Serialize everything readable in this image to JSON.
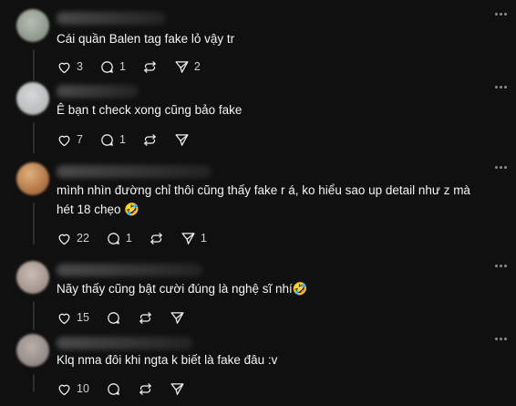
{
  "posts": [
    {
      "text": "Cái quần Balen tag fake lỏ vậy tr",
      "likes": "3",
      "replies": "1",
      "reposts": "",
      "shares": "2",
      "avatar_color": "#9ea69c"
    },
    {
      "text": "Ê bạn t check xong cũng bảo fake",
      "likes": "7",
      "replies": "1",
      "reposts": "",
      "shares": "",
      "avatar_color": "#c4c6c8"
    },
    {
      "text": "mình nhìn đường chỉ thôi cũng thấy fake r á, ko hiểu sao up detail như z mà hét 18 chẹo 🤣",
      "likes": "22",
      "replies": "1",
      "reposts": "",
      "shares": "1",
      "avatar_color": "#c98c58"
    },
    {
      "text": "Nãy thấy cũng bật cười đúng là nghệ sĩ nhí🤣",
      "likes": "15",
      "replies": "",
      "reposts": "",
      "shares": "",
      "avatar_color": "#b7aaa2"
    },
    {
      "text": "Klq nma đôi khi ngta k biết là fake đâu :v",
      "likes": "10",
      "replies": "",
      "reposts": "",
      "shares": "",
      "avatar_color": "#a59c98"
    }
  ]
}
